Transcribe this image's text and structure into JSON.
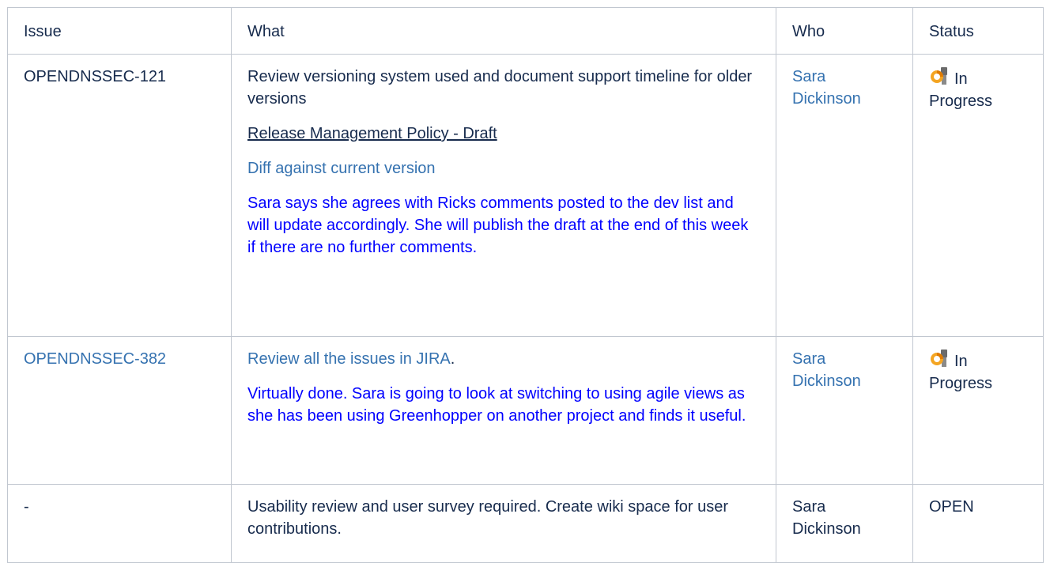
{
  "table": {
    "headers": {
      "issue": "Issue",
      "what": "What",
      "who": "Who",
      "status": "Status"
    },
    "rows": [
      {
        "issue": "OPENDNSSEC-121",
        "what_main": "Review versioning system used and document support timeline for older versions",
        "what_link": "Release Management Policy - Draft",
        "what_diff": "Diff against current version",
        "what_note": "Sara says she agrees with Ricks comments posted to the dev list and will update accordingly. She will publish the draft at the end of this week if there are no further comments.",
        "who": "Sara Dickinson",
        "status": "In Progress"
      },
      {
        "issue": "OPENDNSSEC-382",
        "what_main": "Review all the issues in JIRA",
        "what_main_suffix": ".",
        "what_note": "Virtually done. Sara is going to look at switching to using agile views as she has been using Greenhopper on another project and finds it useful.",
        "who": "Sara Dickinson",
        "status": "In Progress"
      },
      {
        "issue": "-",
        "what_main": "Usability review and user survey required. Create wiki space for user contributions.",
        "who": "Sara Dickinson",
        "status": "OPEN"
      }
    ]
  },
  "colors": {
    "link": "#3572b0",
    "note": "#0000ff",
    "border": "#c1c7d0",
    "text": "#172b4d"
  },
  "icons": {
    "in_progress": "in-progress-status-icon"
  }
}
